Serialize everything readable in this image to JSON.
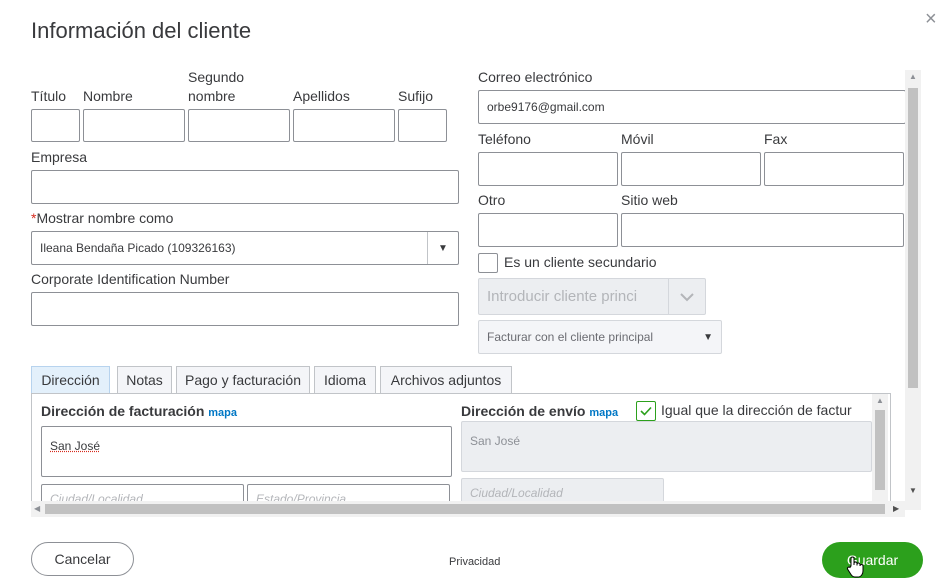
{
  "dialog": {
    "title": "Información del cliente",
    "close_glyph": "×"
  },
  "name_fields": {
    "titulo_label": "Título",
    "nombre_label": "Nombre",
    "segundo_nombre_label_1": "Segundo",
    "segundo_nombre_label_2": "nombre",
    "apellidos_label": "Apellidos",
    "sufijo_label": "Sufijo"
  },
  "empresa_label": "Empresa",
  "mostrar_nombre": {
    "asterisk": "*",
    "label": "Mostrar nombre como",
    "value": "Ileana Bendaña Picado (109326163)"
  },
  "corp_id_label": "Corporate Identification Number",
  "contact": {
    "correo_label": "Correo electrónico",
    "correo_value": "orbe9176@gmail.com",
    "telefono_label": "Teléfono",
    "movil_label": "Móvil",
    "fax_label": "Fax",
    "otro_label": "Otro",
    "sitio_web_label": "Sitio web"
  },
  "subcliente": {
    "checkbox_label": "Es un cliente secundario",
    "parent_placeholder": "Introducir cliente princi",
    "billing_select": "Facturar con el cliente principal"
  },
  "tabs": [
    {
      "label": "Dirección"
    },
    {
      "label": "Notas"
    },
    {
      "label": "Pago y facturación"
    },
    {
      "label": "Idioma"
    },
    {
      "label": "Archivos adjuntos"
    }
  ],
  "billing_address": {
    "label": "Dirección de facturación",
    "map_link": "mapa",
    "street_value": "San José",
    "city_placeholder": "Ciudad/Localidad",
    "state_placeholder": "Estado/Provincia"
  },
  "shipping_address": {
    "label": "Dirección de envío",
    "map_link": "mapa",
    "same_as_label": "Igual que la dirección de factur",
    "street_value": "San José",
    "city_placeholder": "Ciudad/Localidad"
  },
  "footer": {
    "cancel_label": "Cancelar",
    "privacy_label": "Privacidad",
    "save_label": "Guardar"
  },
  "colors": {
    "accent_green": "#2ca01c",
    "link_blue": "#0077c5",
    "required_red": "#d52b1e"
  }
}
